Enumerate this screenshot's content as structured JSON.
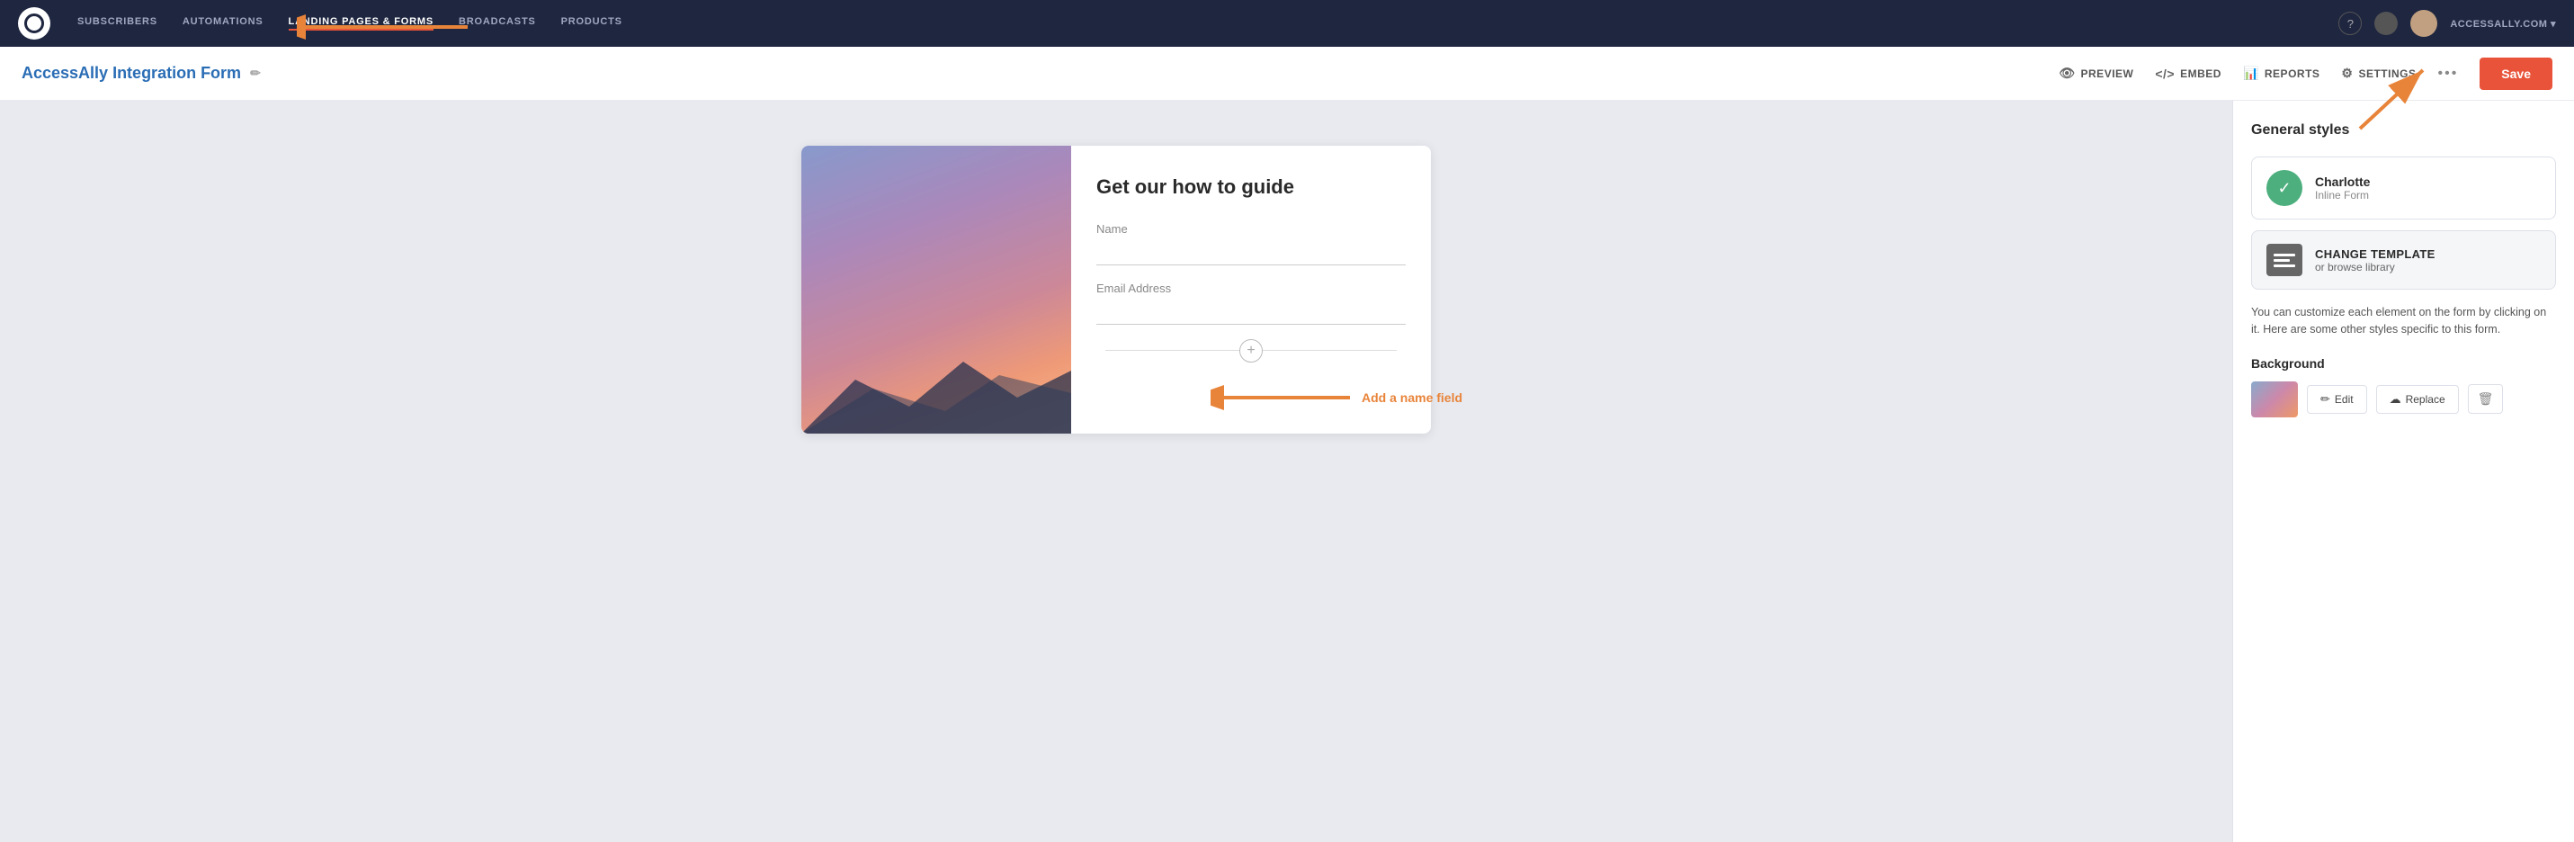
{
  "nav": {
    "logo_alt": "ConvertKit logo",
    "items": [
      {
        "label": "SUBSCRIBERS",
        "active": false
      },
      {
        "label": "AUTOMATIONS",
        "active": false
      },
      {
        "label": "LANDING PAGES & FORMS",
        "active": true
      },
      {
        "label": "BROADCASTS",
        "active": false
      },
      {
        "label": "PRODUCTS",
        "active": false
      }
    ],
    "help_label": "?",
    "account_label": "ACCESSALLY.COM ▾"
  },
  "toolbar": {
    "title": "AccessAlly Integration Form",
    "edit_icon": "✏",
    "preview_label": "PREVIEW",
    "embed_label": "EMBED",
    "reports_label": "REPORTS",
    "settings_label": "SETTINGS",
    "more_label": "•••",
    "save_label": "Save"
  },
  "form_preview": {
    "heading": "Get our how to guide",
    "name_label": "Name",
    "email_label": "Email Address",
    "add_field_icon": "+"
  },
  "annotation": {
    "name_arrow_label": "Add a name field"
  },
  "sidebar": {
    "title": "General styles",
    "template": {
      "name": "Charlotte",
      "type": "Inline Form"
    },
    "change_template": {
      "main_label": "CHANGE TEMPLATE",
      "sub_label": "or browse library"
    },
    "description": "You can customize each element on the form by clicking on it. Here are some other styles specific to this form.",
    "background": {
      "section_label": "Background",
      "edit_label": "Edit",
      "replace_label": "Replace",
      "delete_icon": "🗑"
    }
  }
}
